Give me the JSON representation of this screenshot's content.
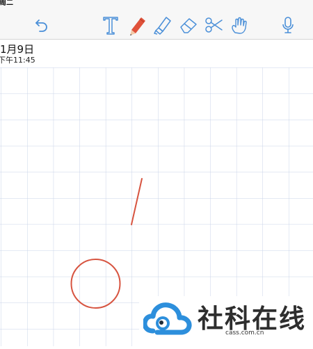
{
  "status_bar": {
    "text": "周二"
  },
  "toolbar": {
    "tools": [
      "undo-icon",
      "text-icon",
      "pen-icon",
      "marker-icon",
      "eraser-icon",
      "scissors-icon",
      "hand-icon",
      "microphone-icon"
    ],
    "active_tool": "pen",
    "pen_color": "#e0523a",
    "icon_color": "#4a8fd8"
  },
  "note": {
    "date": "1月9日",
    "time": "下午11:45"
  },
  "canvas": {
    "background": "grid",
    "grid_color": "#c9d3e8",
    "stroke_color": "#d75440"
  },
  "watermark": {
    "name": "社科在线",
    "domain": "cass.com.cn"
  }
}
